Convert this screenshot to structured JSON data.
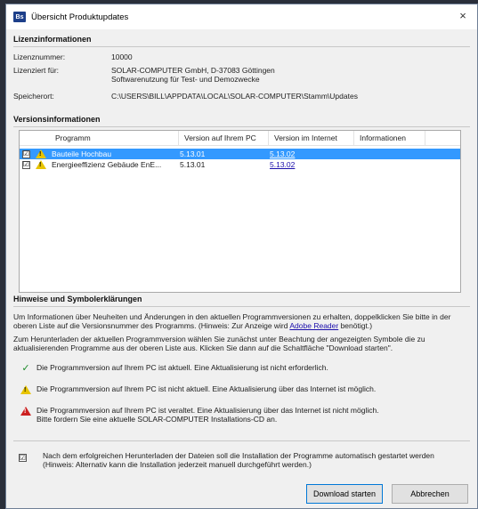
{
  "window": {
    "title": "Übersicht Produktupdates",
    "app_icon": "Bs",
    "close": "×"
  },
  "license": {
    "header": "Lizenzinformationen",
    "number_label": "Lizenznummer:",
    "number_value": "10000",
    "licensed_label": "Lizenziert für:",
    "licensed_line1": "SOLAR-COMPUTER GmbH, D-37083 Göttingen",
    "licensed_line2": "Softwarenutzung für Test- und Demozwecke",
    "storage_label": "Speicherort:",
    "storage_value": "C:\\USERS\\BILL\\APPDATA\\LOCAL\\SOLAR-COMPUTER\\Stamm\\Updates"
  },
  "versions": {
    "header": "Versionsinformationen",
    "columns": [
      "Programm",
      "Version auf Ihrem PC",
      "Version im Internet",
      "Informationen"
    ],
    "rows": [
      {
        "checked": "☑",
        "icon": "warning-icon",
        "program": "Bauteile Hochbau",
        "pc": "5.13.01",
        "internet": "5.13.02",
        "info": "",
        "selected": true
      },
      {
        "checked": "☑",
        "icon": "warning-icon",
        "program": "Energieeffizienz Gebäude EnE...",
        "pc": "5.13.01",
        "internet": "5.13.02",
        "info": "",
        "selected": false
      }
    ]
  },
  "hints": {
    "header": "Hinweise und Symbolerklärungen",
    "para1_a": "Um Informationen über Neuheiten und Änderungen in den aktuellen Programmversionen zu erhalten, doppelklicken Sie bitte in der oberen Liste auf die Versionsnummer des Programms. (Hinweis: Zur Anzeige wird ",
    "para1_link": "Adobe Reader",
    "para1_b": " benötigt.)",
    "para2": "Zum Herunterladen der aktuellen Programmversion wählen Sie zunächst unter Beachtung der angezeigten Symbole die zu aktualisierenden Programme aus der oberen Liste aus. Klicken Sie dann auf die Schaltfläche \"Download starten\".",
    "legend_ok": "Die Programmversion auf Ihrem PC ist aktuell. Eine Aktualisierung ist nicht erforderlich.",
    "legend_warn": "Die Programmversion auf Ihrem PC ist nicht aktuell. Eine Aktualisierung über das Internet ist möglich.",
    "legend_error_1": "Die Programmversion auf Ihrem PC ist veraltet. Eine Aktualisierung über das Internet ist nicht möglich.",
    "legend_error_2": "Bitte fordern Sie eine aktuelle SOLAR-COMPUTER Installations-CD an.",
    "auto_install_1": "Nach dem erfolgreichen Herunterladen der Dateien soll die Installation der Programme automatisch gestartet werden",
    "auto_install_2": "(Hinweis: Alternativ kann die Installation jederzeit manuell durchgeführt werden.)",
    "auto_install_checked": "☑"
  },
  "buttons": {
    "download": "Download starten",
    "cancel": "Abbrechen"
  },
  "colors": {
    "selection": "#3399ff",
    "warning": "#e8c400",
    "error": "#cc2020",
    "ok": "#1e8b2b",
    "link": "#1a0dab"
  }
}
